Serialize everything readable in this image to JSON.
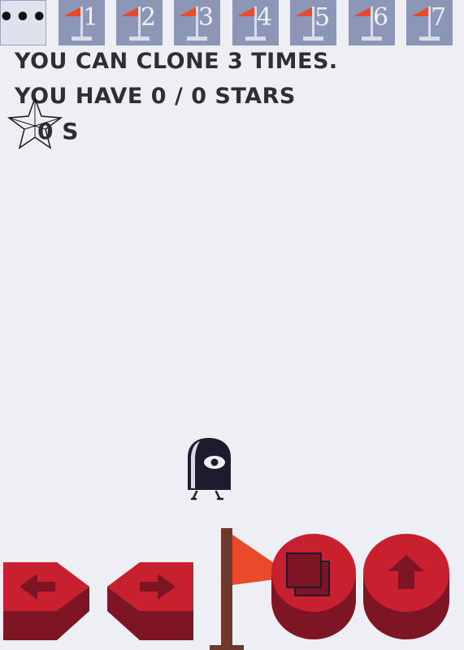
{
  "menu": {
    "label": "•••",
    "icon": "menu-dots-icon"
  },
  "levels": [
    {
      "number": "1"
    },
    {
      "number": "2"
    },
    {
      "number": "3"
    },
    {
      "number": "4"
    },
    {
      "number": "5"
    },
    {
      "number": "6"
    },
    {
      "number": "7"
    }
  ],
  "hud": {
    "clone_text": "YOU CAN CLONE 3 TIMES.",
    "stars_text": "YOU HAVE 0 / 0 STARS",
    "timer_text": "0 S"
  },
  "icons": {
    "star": "star-outline-icon",
    "player": "one-eyed-ghost-character",
    "goal": "red-flag-icon",
    "move_left": "arrow-left-icon",
    "move_right": "arrow-right-icon",
    "clone": "clone-squares-icon",
    "jump": "arrow-up-icon"
  },
  "colors": {
    "background": "#eeeff5",
    "tile": "#8c97b8",
    "button_red": "#c8202e",
    "button_dark": "#7e1524",
    "flag_red": "#e84a2a",
    "pole": "#6b3a2c",
    "text": "#2e2e35"
  }
}
